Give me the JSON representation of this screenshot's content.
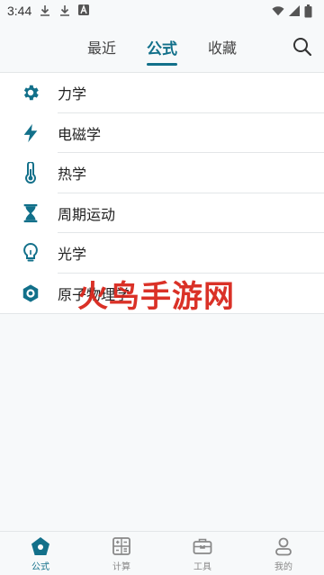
{
  "status_bar": {
    "time": "3:44",
    "icons": [
      "download-icon",
      "download-icon",
      "a-icon",
      "wifi-icon",
      "signal-icon",
      "battery-icon"
    ]
  },
  "top_tabs": [
    {
      "label": "最近",
      "active": false
    },
    {
      "label": "公式",
      "active": true
    },
    {
      "label": "收藏",
      "active": false
    }
  ],
  "search": {
    "icon": "search-icon"
  },
  "accent_color": "#12708a",
  "formula_list": [
    {
      "label": "力学",
      "icon": "gear-icon"
    },
    {
      "label": "电磁学",
      "icon": "lightning-icon"
    },
    {
      "label": "热学",
      "icon": "thermometer-icon"
    },
    {
      "label": "周期运动",
      "icon": "hourglass-icon"
    },
    {
      "label": "光学",
      "icon": "lightbulb-icon"
    },
    {
      "label": "原子物理学",
      "icon": "atom-icon"
    }
  ],
  "watermark": "火鸟手游网",
  "bottom_nav": [
    {
      "label": "公式",
      "icon": "formula-home-icon",
      "active": true
    },
    {
      "label": "计算",
      "icon": "calculator-icon",
      "active": false
    },
    {
      "label": "工具",
      "icon": "toolbox-icon",
      "active": false
    },
    {
      "label": "我的",
      "icon": "user-icon",
      "active": false
    }
  ]
}
